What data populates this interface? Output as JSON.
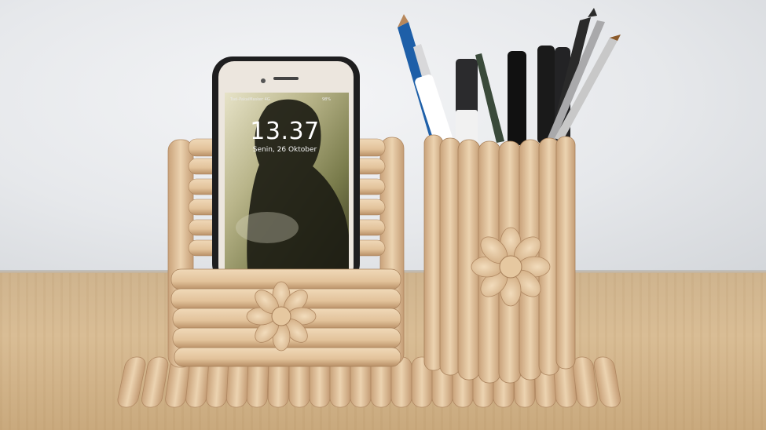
{
  "photo": {
    "subject": "popsicle-stick desk organizer",
    "phone_screen": {
      "time": "13.37",
      "date": "Senin, 26 Oktober",
      "carrier": "Tsel-PakaiMasker 4G",
      "battery": "98%"
    }
  }
}
